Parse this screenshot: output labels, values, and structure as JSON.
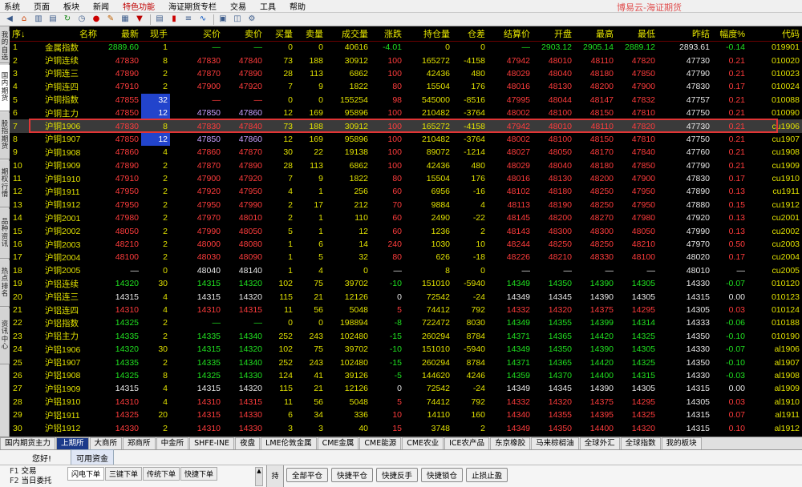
{
  "menu": [
    "系统",
    "页面",
    "板块",
    "新闻",
    "特色功能",
    "海证期货专栏",
    "交易",
    "工具",
    "帮助"
  ],
  "brand": "博易云-海证期货",
  "toolbar_icons": [
    "back-icon",
    "home-icon",
    "chart-icon",
    "quote-icon",
    "refresh-icon",
    "clock-icon",
    "record-icon",
    "pen-icon",
    "grid-icon",
    "filter-icon",
    "table-icon",
    "kline-icon",
    "list-icon",
    "timeshare-icon",
    "report-icon",
    "layout-icon",
    "settings-icon"
  ],
  "left_tabs": [
    "我的自选",
    "国内期货",
    "股指期货",
    "期权行情",
    "品种资讯",
    "热点排名",
    "资讯中心"
  ],
  "columns": [
    "序↓",
    "名称",
    "最新",
    "现手",
    "买价",
    "卖价",
    "买量",
    "卖量",
    "成交量",
    "涨跌",
    "持仓量",
    "仓差",
    "结算价",
    "开盘",
    "最高",
    "最低",
    "昨结",
    "幅度%",
    "代码"
  ],
  "rows": [
    {
      "no": "1",
      "name": "金属指数",
      "last": "2889.60",
      "vol": "1",
      "bid": "—",
      "ask": "—",
      "bidv": "0",
      "askv": "0",
      "tvol": "40616",
      "chg": "-4.01",
      "oi": "0",
      "oid": "0",
      "settle": "—",
      "open": "2903.12",
      "high": "2905.14",
      "low": "2889.12",
      "prev": "2893.61",
      "pct": "-0.14",
      "code": "019901",
      "c": "g"
    },
    {
      "no": "2",
      "name": "沪铜连续",
      "last": "47830",
      "vol": "8",
      "bid": "47830",
      "ask": "47840",
      "bidv": "73",
      "askv": "188",
      "tvol": "30912",
      "chg": "100",
      "oi": "165272",
      "oid": "-4158",
      "settle": "47942",
      "open": "48010",
      "high": "48110",
      "low": "47820",
      "prev": "47730",
      "pct": "0.21",
      "code": "010020",
      "c": "r"
    },
    {
      "no": "3",
      "name": "沪铜连三",
      "last": "47890",
      "vol": "2",
      "bid": "47870",
      "ask": "47890",
      "bidv": "28",
      "askv": "113",
      "tvol": "6862",
      "chg": "100",
      "oi": "42436",
      "oid": "480",
      "settle": "48029",
      "open": "48040",
      "high": "48180",
      "low": "47850",
      "prev": "47790",
      "pct": "0.21",
      "code": "010023",
      "c": "r"
    },
    {
      "no": "4",
      "name": "沪铜连四",
      "last": "47910",
      "vol": "2",
      "bid": "47900",
      "ask": "47920",
      "bidv": "7",
      "askv": "9",
      "tvol": "1822",
      "chg": "80",
      "oi": "15504",
      "oid": "176",
      "settle": "48016",
      "open": "48130",
      "high": "48200",
      "low": "47900",
      "prev": "47830",
      "pct": "0.17",
      "code": "010024",
      "c": "r"
    },
    {
      "no": "5",
      "name": "沪铜指数",
      "last": "47855",
      "vol": "32",
      "bid": "—",
      "ask": "—",
      "bidv": "0",
      "askv": "0",
      "tvol": "155254",
      "chg": "98",
      "oi": "545000",
      "oid": "-8516",
      "settle": "47995",
      "open": "48044",
      "high": "48147",
      "low": "47832",
      "prev": "47757",
      "pct": "0.21",
      "code": "010088",
      "c": "r",
      "box": true
    },
    {
      "no": "6",
      "name": "沪铜主力",
      "last": "47850",
      "vol": "12",
      "bid": "47850",
      "ask": "47860",
      "bidv": "12",
      "askv": "169",
      "tvol": "95896",
      "chg": "100",
      "oi": "210482",
      "oid": "-3764",
      "settle": "48002",
      "open": "48100",
      "high": "48150",
      "low": "47810",
      "prev": "47750",
      "pct": "0.21",
      "code": "010090",
      "c": "r",
      "box": true
    },
    {
      "no": "7",
      "name": "沪铜1906",
      "last": "47830",
      "vol": "8",
      "bid": "47830",
      "ask": "47840",
      "bidv": "73",
      "askv": "188",
      "tvol": "30912",
      "chg": "100",
      "oi": "165272",
      "oid": "-4158",
      "settle": "47942",
      "open": "48010",
      "high": "48110",
      "low": "47820",
      "prev": "47730",
      "pct": "0.21",
      "code": "cu1906",
      "c": "r",
      "sel": true
    },
    {
      "no": "8",
      "name": "沪铜1907",
      "last": "47850",
      "vol": "12",
      "bid": "47850",
      "ask": "47860",
      "bidv": "12",
      "askv": "169",
      "tvol": "95896",
      "chg": "100",
      "oi": "210482",
      "oid": "-3764",
      "settle": "48002",
      "open": "48100",
      "high": "48150",
      "low": "47810",
      "prev": "47750",
      "pct": "0.21",
      "code": "cu1907",
      "c": "r",
      "box": true
    },
    {
      "no": "9",
      "name": "沪铜1908",
      "last": "47860",
      "vol": "4",
      "bid": "47860",
      "ask": "47870",
      "bidv": "30",
      "askv": "22",
      "tvol": "19138",
      "chg": "100",
      "oi": "89072",
      "oid": "-1214",
      "settle": "48027",
      "open": "48050",
      "high": "48170",
      "low": "47840",
      "prev": "47760",
      "pct": "0.21",
      "code": "cu1908",
      "c": "r"
    },
    {
      "no": "10",
      "name": "沪铜1909",
      "last": "47890",
      "vol": "2",
      "bid": "47870",
      "ask": "47890",
      "bidv": "28",
      "askv": "113",
      "tvol": "6862",
      "chg": "100",
      "oi": "42436",
      "oid": "480",
      "settle": "48029",
      "open": "48040",
      "high": "48180",
      "low": "47850",
      "prev": "47790",
      "pct": "0.21",
      "code": "cu1909",
      "c": "r"
    },
    {
      "no": "11",
      "name": "沪铜1910",
      "last": "47910",
      "vol": "2",
      "bid": "47900",
      "ask": "47920",
      "bidv": "7",
      "askv": "9",
      "tvol": "1822",
      "chg": "80",
      "oi": "15504",
      "oid": "176",
      "settle": "48016",
      "open": "48130",
      "high": "48200",
      "low": "47900",
      "prev": "47830",
      "pct": "0.17",
      "code": "cu1910",
      "c": "r"
    },
    {
      "no": "12",
      "name": "沪铜1911",
      "last": "47950",
      "vol": "2",
      "bid": "47920",
      "ask": "47950",
      "bidv": "4",
      "askv": "1",
      "tvol": "256",
      "chg": "60",
      "oi": "6956",
      "oid": "-16",
      "settle": "48102",
      "open": "48180",
      "high": "48250",
      "low": "47950",
      "prev": "47890",
      "pct": "0.13",
      "code": "cu1911",
      "c": "r"
    },
    {
      "no": "13",
      "name": "沪铜1912",
      "last": "47950",
      "vol": "2",
      "bid": "47950",
      "ask": "47990",
      "bidv": "2",
      "askv": "17",
      "tvol": "212",
      "chg": "70",
      "oi": "9884",
      "oid": "4",
      "settle": "48113",
      "open": "48190",
      "high": "48250",
      "low": "47950",
      "prev": "47880",
      "pct": "0.15",
      "code": "cu1912",
      "c": "r"
    },
    {
      "no": "14",
      "name": "沪铜2001",
      "last": "47980",
      "vol": "2",
      "bid": "47970",
      "ask": "48010",
      "bidv": "2",
      "askv": "1",
      "tvol": "110",
      "chg": "60",
      "oi": "2490",
      "oid": "-22",
      "settle": "48145",
      "open": "48200",
      "high": "48270",
      "low": "47980",
      "prev": "47920",
      "pct": "0.13",
      "code": "cu2001",
      "c": "r"
    },
    {
      "no": "15",
      "name": "沪铜2002",
      "last": "48050",
      "vol": "2",
      "bid": "47990",
      "ask": "48050",
      "bidv": "5",
      "askv": "1",
      "tvol": "12",
      "chg": "60",
      "oi": "1236",
      "oid": "2",
      "settle": "48143",
      "open": "48300",
      "high": "48300",
      "low": "48050",
      "prev": "47990",
      "pct": "0.13",
      "code": "cu2002",
      "c": "r"
    },
    {
      "no": "16",
      "name": "沪铜2003",
      "last": "48210",
      "vol": "2",
      "bid": "48000",
      "ask": "48080",
      "bidv": "1",
      "askv": "6",
      "tvol": "14",
      "chg": "240",
      "oi": "1030",
      "oid": "10",
      "settle": "48244",
      "open": "48250",
      "high": "48250",
      "low": "48210",
      "prev": "47970",
      "pct": "0.50",
      "code": "cu2003",
      "c": "r"
    },
    {
      "no": "17",
      "name": "沪铜2004",
      "last": "48100",
      "vol": "2",
      "bid": "48030",
      "ask": "48090",
      "bidv": "1",
      "askv": "5",
      "tvol": "32",
      "chg": "80",
      "oi": "626",
      "oid": "-18",
      "settle": "48226",
      "open": "48210",
      "high": "48330",
      "low": "48100",
      "prev": "48020",
      "pct": "0.17",
      "code": "cu2004",
      "c": "r"
    },
    {
      "no": "18",
      "name": "沪铜2005",
      "last": "—",
      "vol": "0",
      "bid": "48040",
      "ask": "48140",
      "bidv": "1",
      "askv": "4",
      "tvol": "0",
      "chg": "—",
      "oi": "8",
      "oid": "0",
      "settle": "—",
      "open": "—",
      "high": "—",
      "low": "—",
      "prev": "48010",
      "pct": "—",
      "code": "cu2005",
      "c": "w"
    },
    {
      "no": "19",
      "name": "沪铝连续",
      "last": "14320",
      "vol": "30",
      "bid": "14315",
      "ask": "14320",
      "bidv": "102",
      "askv": "75",
      "tvol": "39702",
      "chg": "-10",
      "oi": "151010",
      "oid": "-5940",
      "settle": "14349",
      "open": "14350",
      "high": "14390",
      "low": "14305",
      "prev": "14330",
      "pct": "-0.07",
      "code": "010120",
      "c": "g"
    },
    {
      "no": "20",
      "name": "沪铝连三",
      "last": "14315",
      "vol": "4",
      "bid": "14315",
      "ask": "14320",
      "bidv": "115",
      "askv": "21",
      "tvol": "12126",
      "chg": "0",
      "oi": "72542",
      "oid": "-24",
      "settle": "14349",
      "open": "14345",
      "high": "14390",
      "low": "14305",
      "prev": "14315",
      "pct": "0.00",
      "code": "010123",
      "c": "w"
    },
    {
      "no": "21",
      "name": "沪铝连四",
      "last": "14310",
      "vol": "4",
      "bid": "14310",
      "ask": "14315",
      "bidv": "11",
      "askv": "56",
      "tvol": "5048",
      "chg": "5",
      "oi": "74412",
      "oid": "792",
      "settle": "14332",
      "open": "14320",
      "high": "14375",
      "low": "14295",
      "prev": "14305",
      "pct": "0.03",
      "code": "010124",
      "c": "r"
    },
    {
      "no": "22",
      "name": "沪铝指数",
      "last": "14325",
      "vol": "2",
      "bid": "—",
      "ask": "—",
      "bidv": "0",
      "askv": "0",
      "tvol": "198894",
      "chg": "-8",
      "oi": "722472",
      "oid": "8030",
      "settle": "14349",
      "open": "14355",
      "high": "14399",
      "low": "14314",
      "prev": "14333",
      "pct": "-0.06",
      "code": "010188",
      "c": "g"
    },
    {
      "no": "23",
      "name": "沪铝主力",
      "last": "14335",
      "vol": "2",
      "bid": "14335",
      "ask": "14340",
      "bidv": "252",
      "askv": "243",
      "tvol": "102480",
      "chg": "-15",
      "oi": "260294",
      "oid": "8784",
      "settle": "14371",
      "open": "14365",
      "high": "14420",
      "low": "14325",
      "prev": "14350",
      "pct": "-0.10",
      "code": "010190",
      "c": "g"
    },
    {
      "no": "24",
      "name": "沪铝1906",
      "last": "14320",
      "vol": "30",
      "bid": "14315",
      "ask": "14320",
      "bidv": "102",
      "askv": "75",
      "tvol": "39702",
      "chg": "-10",
      "oi": "151010",
      "oid": "-5940",
      "settle": "14349",
      "open": "14350",
      "high": "14390",
      "low": "14305",
      "prev": "14330",
      "pct": "-0.07",
      "code": "al1906",
      "c": "g"
    },
    {
      "no": "25",
      "name": "沪铝1907",
      "last": "14335",
      "vol": "2",
      "bid": "14335",
      "ask": "14340",
      "bidv": "252",
      "askv": "243",
      "tvol": "102480",
      "chg": "-15",
      "oi": "260294",
      "oid": "8784",
      "settle": "14371",
      "open": "14365",
      "high": "14420",
      "low": "14325",
      "prev": "14350",
      "pct": "-0.10",
      "code": "al1907",
      "c": "g"
    },
    {
      "no": "26",
      "name": "沪铝1908",
      "last": "14325",
      "vol": "8",
      "bid": "14325",
      "ask": "14330",
      "bidv": "124",
      "askv": "41",
      "tvol": "39126",
      "chg": "-5",
      "oi": "144620",
      "oid": "4246",
      "settle": "14359",
      "open": "14370",
      "high": "14400",
      "low": "14315",
      "prev": "14330",
      "pct": "-0.03",
      "code": "al1908",
      "c": "g"
    },
    {
      "no": "27",
      "name": "沪铝1909",
      "last": "14315",
      "vol": "4",
      "bid": "14315",
      "ask": "14320",
      "bidv": "115",
      "askv": "21",
      "tvol": "12126",
      "chg": "0",
      "oi": "72542",
      "oid": "-24",
      "settle": "14349",
      "open": "14345",
      "high": "14390",
      "low": "14305",
      "prev": "14315",
      "pct": "0.00",
      "code": "al1909",
      "c": "w"
    },
    {
      "no": "28",
      "name": "沪铝1910",
      "last": "14310",
      "vol": "4",
      "bid": "14310",
      "ask": "14315",
      "bidv": "11",
      "askv": "56",
      "tvol": "5048",
      "chg": "5",
      "oi": "74412",
      "oid": "792",
      "settle": "14332",
      "open": "14320",
      "high": "14375",
      "low": "14295",
      "prev": "14305",
      "pct": "0.03",
      "code": "al1910",
      "c": "r"
    },
    {
      "no": "29",
      "name": "沪铝1911",
      "last": "14325",
      "vol": "20",
      "bid": "14315",
      "ask": "14330",
      "bidv": "6",
      "askv": "34",
      "tvol": "336",
      "chg": "10",
      "oi": "14110",
      "oid": "160",
      "settle": "14340",
      "open": "14355",
      "high": "14395",
      "low": "14325",
      "prev": "14315",
      "pct": "0.07",
      "code": "al1911",
      "c": "r"
    },
    {
      "no": "30",
      "name": "沪铝1912",
      "last": "14330",
      "vol": "2",
      "bid": "14310",
      "ask": "14330",
      "bidv": "3",
      "askv": "3",
      "tvol": "40",
      "chg": "15",
      "oi": "3748",
      "oid": "2",
      "settle": "14349",
      "open": "14350",
      "high": "14400",
      "low": "14320",
      "prev": "14315",
      "pct": "0.10",
      "code": "al1912",
      "c": "r"
    }
  ],
  "bottom_tabs": [
    "国内期货主力",
    "上期所",
    "大商所",
    "郑商所",
    "中金所",
    "SHFE-INE",
    "夜盘",
    "LME伦敦金属",
    "CME金属",
    "CME能源",
    "CME农业",
    "ICE农产品",
    "东京橡胶",
    "马来棕榈油",
    "全球外汇",
    "全球指数",
    "我的板块"
  ],
  "bottom_active": 1,
  "greeting": "您好!",
  "funds_tab": "可用资金",
  "trade_left": [
    {
      "key": "F1",
      "label": "交易"
    },
    {
      "key": "F2",
      "label": "当日委托"
    }
  ],
  "order_tabs": [
    "闪电下单",
    "三键下单",
    "传统下单",
    "快捷下单"
  ],
  "side_label": "持",
  "action_buttons": [
    "全部平仓",
    "快捷平仓",
    "快捷反手",
    "快捷锁仓",
    "止损止盈"
  ],
  "colors": {
    "up": "#ff3c3c",
    "down": "#20e020",
    "yellow": "#e0e000",
    "select_border": "#e23535",
    "box": "#2244cc"
  }
}
